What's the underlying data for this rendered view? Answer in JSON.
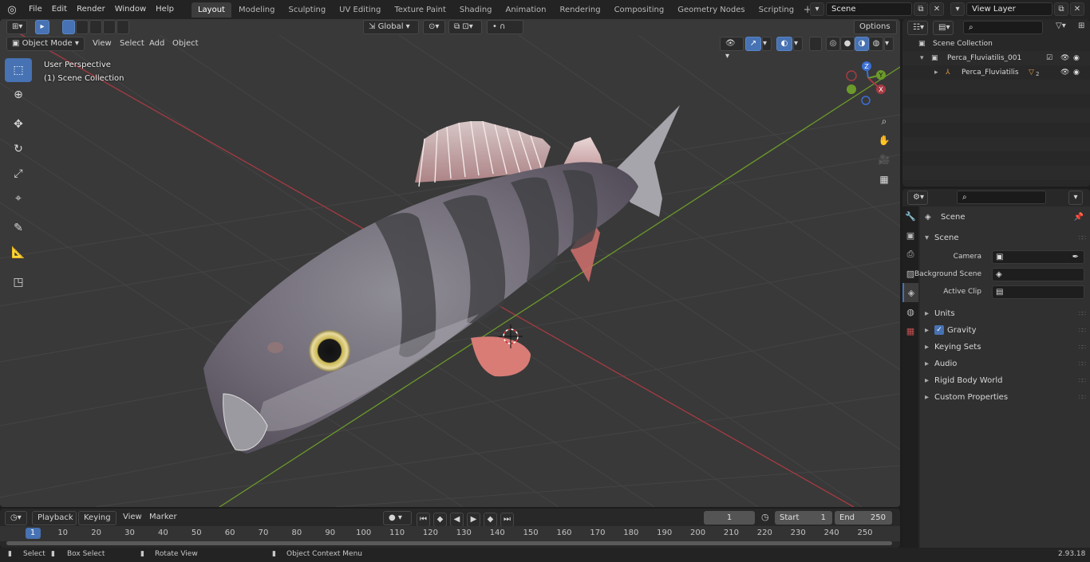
{
  "topbar": {
    "menus": [
      "File",
      "Edit",
      "Render",
      "Window",
      "Help"
    ],
    "workspaces": [
      "Layout",
      "Modeling",
      "Sculpting",
      "UV Editing",
      "Texture Paint",
      "Shading",
      "Animation",
      "Rendering",
      "Compositing",
      "Geometry Nodes",
      "Scripting"
    ],
    "active_workspace": "Layout",
    "scene_name": "Scene",
    "view_layer": "View Layer"
  },
  "viewport": {
    "mode": "Object Mode",
    "menus": [
      "View",
      "Select",
      "Add",
      "Object"
    ],
    "orientation": "Global",
    "options_label": "Options",
    "overlay_line1": "User Perspective",
    "overlay_line2": "(1) Scene Collection",
    "gizmo_axes": [
      "X",
      "Y",
      "Z"
    ]
  },
  "timeline": {
    "menus": [
      "Playback",
      "Keying",
      "View",
      "Marker"
    ],
    "current_frame": "1",
    "start_label": "Start",
    "start_value": "1",
    "end_label": "End",
    "end_value": "250",
    "ruler_ticks": [
      "1",
      "10",
      "20",
      "30",
      "40",
      "50",
      "60",
      "70",
      "80",
      "90",
      "100",
      "110",
      "120",
      "130",
      "140",
      "150",
      "160",
      "170",
      "180",
      "190",
      "200",
      "210",
      "220",
      "230",
      "240",
      "250"
    ]
  },
  "statusbar": {
    "select": "Select",
    "box_select": "Box Select",
    "rotate_view": "Rotate View",
    "context_menu": "Object Context Menu",
    "version": "2.93.18"
  },
  "outliner": {
    "root": "Scene Collection",
    "collection": "Perca_Fluviatilis_001",
    "object": "Perca_Fluviatilis",
    "badge": "2"
  },
  "properties": {
    "context": "Scene",
    "panel": "Scene",
    "camera_label": "Camera",
    "background_label": "Background Scene",
    "clip_label": "Active Clip",
    "subpanels": [
      "Units",
      "Gravity",
      "Keying Sets",
      "Audio",
      "Rigid Body World",
      "Custom Properties"
    ],
    "gravity_checked": true
  },
  "colors": {
    "accent": "#4772b3",
    "x_axis": "#a63a43",
    "y_axis": "#6c9a2a",
    "z_axis": "#3b6fd6"
  }
}
